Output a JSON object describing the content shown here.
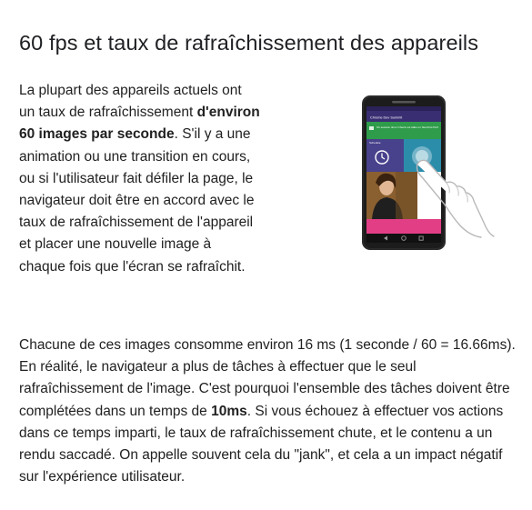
{
  "heading": "60 fps et taux de rafraîchissement des appareils",
  "intro": {
    "before": "La plupart des appareils actuels ont un taux de rafraîchissement ",
    "bold": "d'environ 60 images par seconde",
    "after": ". S'il y a une animation ou une transition en cours, ou si l'utilisateur fait défiler la page, le navigateur doit être en accord avec le taux de rafraîchissement de l'appareil et placer une nouvelle image à chaque fois que l'écran se rafraîchit."
  },
  "paragraph": {
    "before": "Chacune de ces images consomme environ 16 ms (1 seconde / 60 = 16.66ms). En réalité, le navigateur a plus de tâches à effectuer que le seul rafraîchissement de l'image. C'est pourquoi l'ensemble des tâches doivent être complétées dans un temps de ",
    "bold": "10ms",
    "after": ". Si vous échouez à effectuer vos actions dans ce temps imparti, le taux de rafraîchissement chute, et le contenu a un rendu saccadé. On appelle souvent cela du \"jank\", et cela a un impact négatif sur l'expérience utilisateur."
  },
  "phone": {
    "app_title": "Chrome Dev Summit",
    "notification": "It's session time! Check out talks on Net-First Perf",
    "tile_label": "Schedule",
    "icons": [
      "clock-icon",
      "hand-pointer-icon",
      "back-nav-icon",
      "home-nav-icon",
      "recents-nav-icon"
    ],
    "colors": {
      "toolbar": "#3a2e73",
      "notification": "#2e9c4a",
      "tile_left": "#48418c",
      "tile_right": "#2c8dab",
      "photo_bg": "#8a6030",
      "pink_tile": "#e23e86"
    }
  }
}
